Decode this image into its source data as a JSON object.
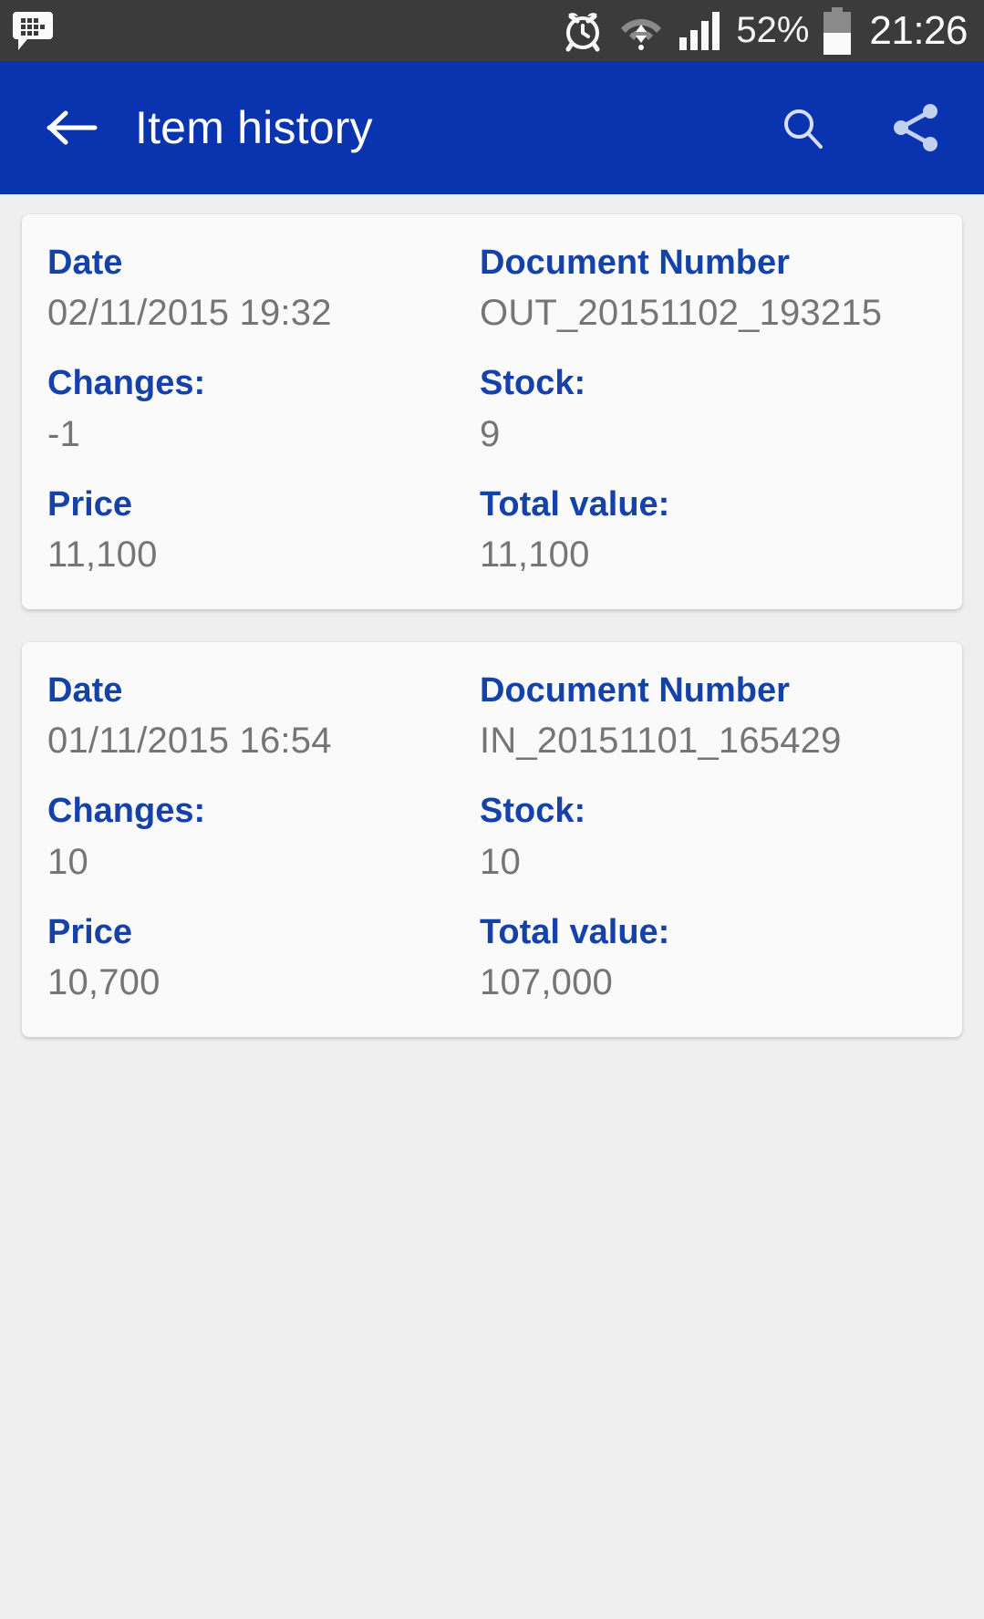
{
  "status_bar": {
    "background_color": "#3B3B3B",
    "notification_icon": "bbm-chat-icon",
    "alarm_icon": "alarm-clock-icon",
    "wifi_icon": "wifi-icon",
    "signal_icon": "cellular-signal-icon",
    "battery_percent": "52%",
    "battery_icon": "battery-icon",
    "clock": "21:26"
  },
  "app_bar": {
    "background_color": "#0A33AF",
    "back_icon": "arrow-left-icon",
    "title": "Item history",
    "search_icon": "search-icon",
    "share_icon": "share-icon"
  },
  "theme": {
    "page_background": "#EFEFEF",
    "card_background": "#FAFAFA",
    "label_color": "#1442A8",
    "value_color": "#757575"
  },
  "history": {
    "cards": [
      {
        "fields": [
          {
            "label": "Date",
            "value": "02/11/2015 19:32"
          },
          {
            "label": "Document Number",
            "value": "OUT_20151102_193215"
          },
          {
            "label": "Changes:",
            "value": "-1"
          },
          {
            "label": "Stock:",
            "value": "9"
          },
          {
            "label": "Price",
            "value": "11,100"
          },
          {
            "label": "Total value:",
            "value": "11,100"
          }
        ]
      },
      {
        "fields": [
          {
            "label": "Date",
            "value": "01/11/2015 16:54"
          },
          {
            "label": "Document Number",
            "value": "IN_20151101_165429"
          },
          {
            "label": "Changes:",
            "value": "10"
          },
          {
            "label": "Stock:",
            "value": "10"
          },
          {
            "label": "Price",
            "value": "10,700"
          },
          {
            "label": "Total value:",
            "value": "107,000"
          }
        ]
      }
    ]
  }
}
